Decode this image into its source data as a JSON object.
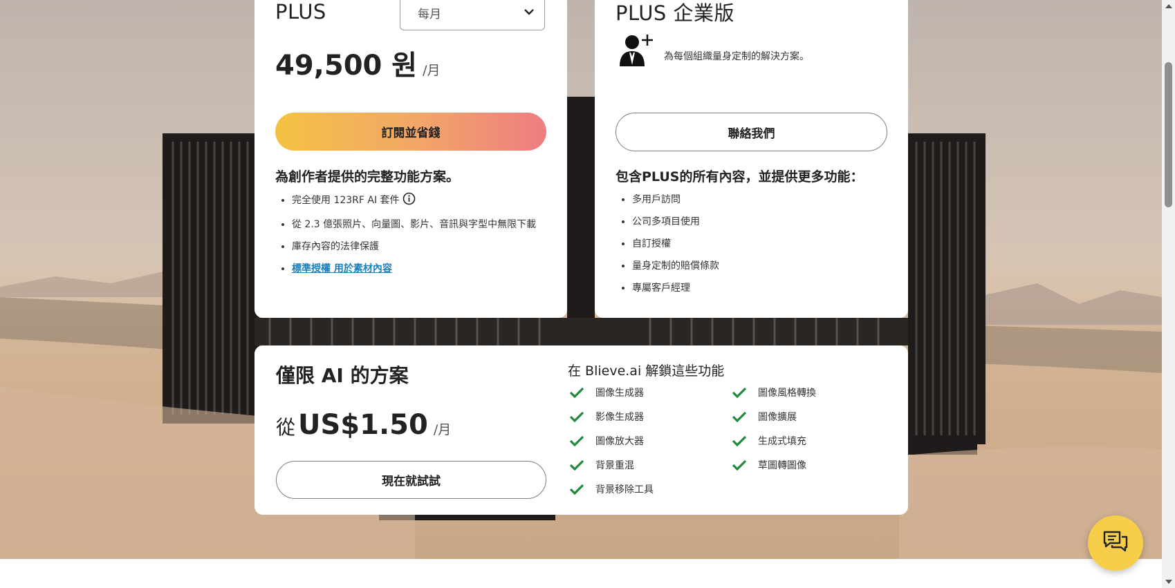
{
  "plus_card": {
    "title": "PLUS",
    "billing_select": {
      "value": "每月"
    },
    "price": "49,500 원",
    "per_period": "/月",
    "subscribe_button": "訂閱並省錢",
    "description": "為創作者提供的完整功能方案。",
    "features": [
      "完全使用 123RF AI 套件",
      "從 2.3 億張照片、向量圖、影片、音訊與字型中無限下載",
      "庫存內容的法律保護"
    ],
    "license_link": "標準授權 用於素材內容"
  },
  "enterprise_card": {
    "title": "PLUS 企業版",
    "tagline": "為每個組織量身定制的解決方案。",
    "contact_button": "聯絡我們",
    "description": "包含PLUS的所有內容，並提供更多功能：",
    "features": [
      "多用戶訪問",
      "公司多項目使用",
      "自訂授權",
      "量身定制的賠償條款",
      "專屬客戶經理"
    ]
  },
  "ai_card": {
    "title": "僅限 AI 的方案",
    "price_prefix": "從",
    "price": "US$1.50",
    "per_period": "/月",
    "try_button": "現在就試試",
    "unlock_title": "在 Blieve.ai 解鎖這些功能",
    "features_left": [
      "圖像生成器",
      "影像生成器",
      "圖像放大器",
      "背景重混",
      "背景移除工具"
    ],
    "features_right": [
      "圖像風格轉換",
      "圖像擴展",
      "生成式填充",
      "草圖轉圖像"
    ]
  },
  "colors": {
    "accent_gradient_start": "#f4c242",
    "accent_gradient_end": "#ee7d82",
    "check_green": "#1f8a3b",
    "link_blue": "#1a7fb8",
    "chat_yellow": "#f6ce4a"
  },
  "icons": {
    "chat": "chat-bubbles-icon",
    "check": "check-icon",
    "info": "info-icon",
    "add_user": "add-user-icon",
    "chevron": "chevron-down-icon"
  }
}
